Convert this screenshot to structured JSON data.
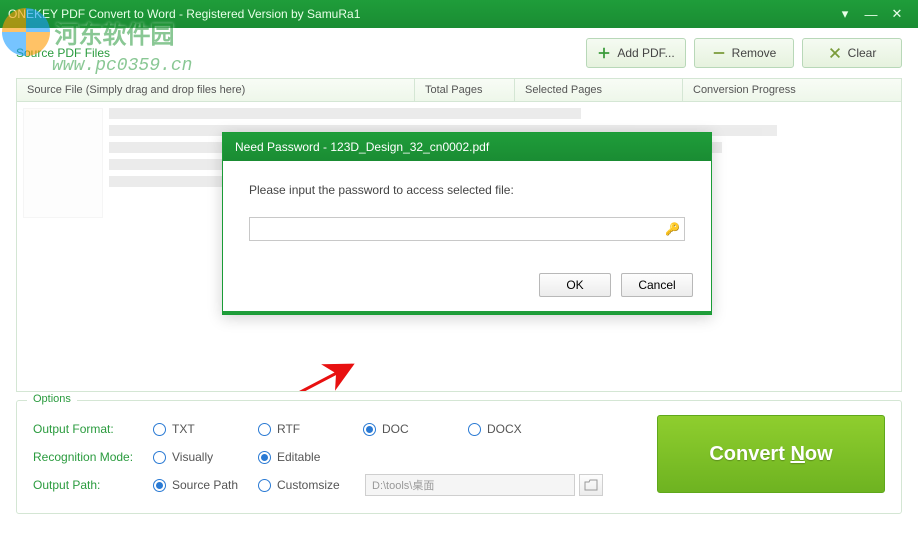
{
  "titlebar": {
    "title": "ONEKEY PDF Convert to Word - Registered Version by SamuRa1"
  },
  "watermark": {
    "text": "河东软件园",
    "url": "www.pc0359.cn"
  },
  "toolbar": {
    "section_title": "Source PDF Files",
    "add_pdf": "Add PDF...",
    "remove": "Remove",
    "clear": "Clear"
  },
  "table": {
    "headers": {
      "source": "Source File (Simply drag and drop files here)",
      "total": "Total Pages",
      "selected": "Selected Pages",
      "progress": "Conversion Progress"
    }
  },
  "dialog": {
    "title": "Need Password - 123D_Design_32_cn0002.pdf",
    "prompt": "Please input the password to access selected file:",
    "value": "",
    "ok": "OK",
    "cancel": "Cancel"
  },
  "options": {
    "frame_label": "Options",
    "output_format_label": "Output Format:",
    "formats": {
      "txt": "TXT",
      "rtf": "RTF",
      "doc": "DOC",
      "docx": "DOCX"
    },
    "format_selected": "doc",
    "recognition_label": "Recognition Mode:",
    "modes": {
      "visually": "Visually",
      "editable": "Editable"
    },
    "mode_selected": "editable",
    "output_path_label": "Output Path:",
    "path_modes": {
      "source": "Source Path",
      "custom": "Customsize"
    },
    "path_selected": "source",
    "path_value": "D:\\tools\\桌面"
  },
  "convert": {
    "label_pre": "Convert ",
    "label_key": "N",
    "label_post": "ow"
  }
}
